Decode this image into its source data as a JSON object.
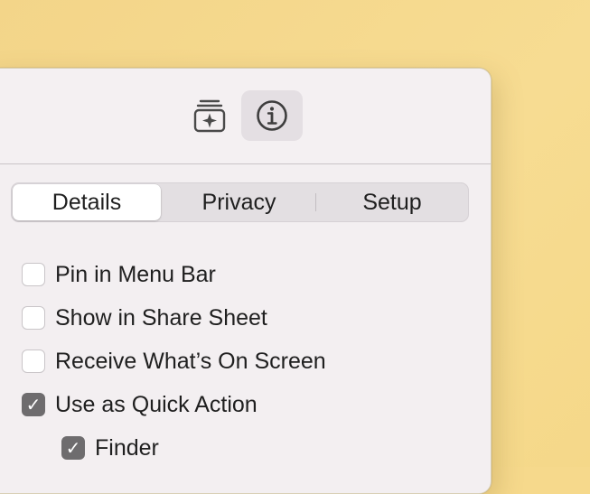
{
  "toolbar": {
    "buttons": [
      {
        "icon": "gallery-sparkle-icon",
        "selected": false
      },
      {
        "icon": "info-icon",
        "selected": true
      }
    ]
  },
  "tabs": {
    "items": [
      {
        "label": "Details",
        "selected": true
      },
      {
        "label": "Privacy",
        "selected": false
      },
      {
        "label": "Setup",
        "selected": false
      }
    ]
  },
  "options": [
    {
      "label": "Pin in Menu Bar",
      "checked": false
    },
    {
      "label": "Show in Share Sheet",
      "checked": false
    },
    {
      "label": "Receive What’s On Screen",
      "checked": false
    },
    {
      "label": "Use as Quick Action",
      "checked": true
    },
    {
      "label": "Finder",
      "checked": true
    }
  ],
  "checkmark_glyph": "✓"
}
